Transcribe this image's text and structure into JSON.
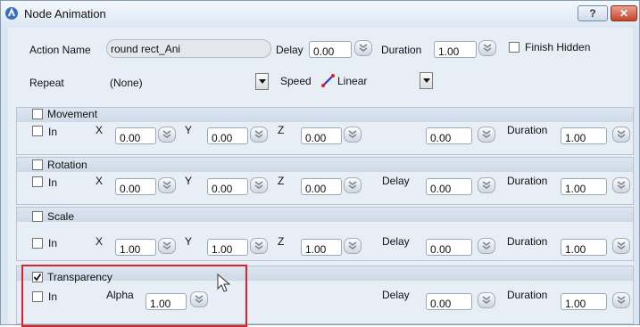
{
  "window": {
    "title": "Node Animation",
    "help_label": "?",
    "close_label": "✕"
  },
  "action": {
    "name_label": "Action Name",
    "name_value": "round rect_Ani",
    "delay_label": "Delay",
    "delay_value": "0.00",
    "duration_label": "Duration",
    "duration_value": "1.00",
    "finish_hidden_label": "Finish Hidden",
    "finish_hidden_checked": false
  },
  "repeat": {
    "label": "Repeat",
    "value": "(None)"
  },
  "speed": {
    "label": "Speed",
    "value": "Linear"
  },
  "sections": {
    "movement": {
      "title": "Movement",
      "checked": false,
      "in_label": "In",
      "in_checked": false,
      "x_label": "X",
      "x": "0.00",
      "y_label": "Y",
      "y": "0.00",
      "z_label": "Z",
      "z": "0.00",
      "delay_label": "",
      "delay": "0.00",
      "duration_label": "Duration",
      "duration": "1.00"
    },
    "rotation": {
      "title": "Rotation",
      "checked": false,
      "in_label": "In",
      "in_checked": false,
      "x_label": "X",
      "x": "0.00",
      "y_label": "Y",
      "y": "0.00",
      "z_label": "Z",
      "z": "0.00",
      "delay_label": "Delay",
      "delay": "0.00",
      "duration_label": "Duration",
      "duration": "1.00"
    },
    "scale": {
      "title": "Scale",
      "checked": false,
      "in_label": "In",
      "in_checked": false,
      "x_label": "X",
      "x": "1.00",
      "y_label": "Y",
      "y": "1.00",
      "z_label": "Z",
      "z": "1.00",
      "delay_label": "Delay",
      "delay": "0.00",
      "duration_label": "Duration",
      "duration": "1.00"
    },
    "transparency": {
      "title": "Transparency",
      "checked": true,
      "in_label": "In",
      "in_checked": false,
      "alpha_label": "Alpha",
      "alpha": "1.00",
      "delay_label": "Delay",
      "delay": "0.00",
      "duration_label": "Duration",
      "duration": "1.00"
    }
  },
  "colors": {
    "highlight": "#e0202a",
    "speed_icon_line": "#2233cc",
    "speed_icon_dot": "#e02020",
    "title_icon": "#3a6fc0"
  },
  "icons": {
    "window": "app-icon",
    "spinner": "chevron-double-down-icon",
    "dropdown": "triangle-down-icon",
    "speed": "linear-curve-icon",
    "cursor": "mouse-pointer-icon"
  }
}
